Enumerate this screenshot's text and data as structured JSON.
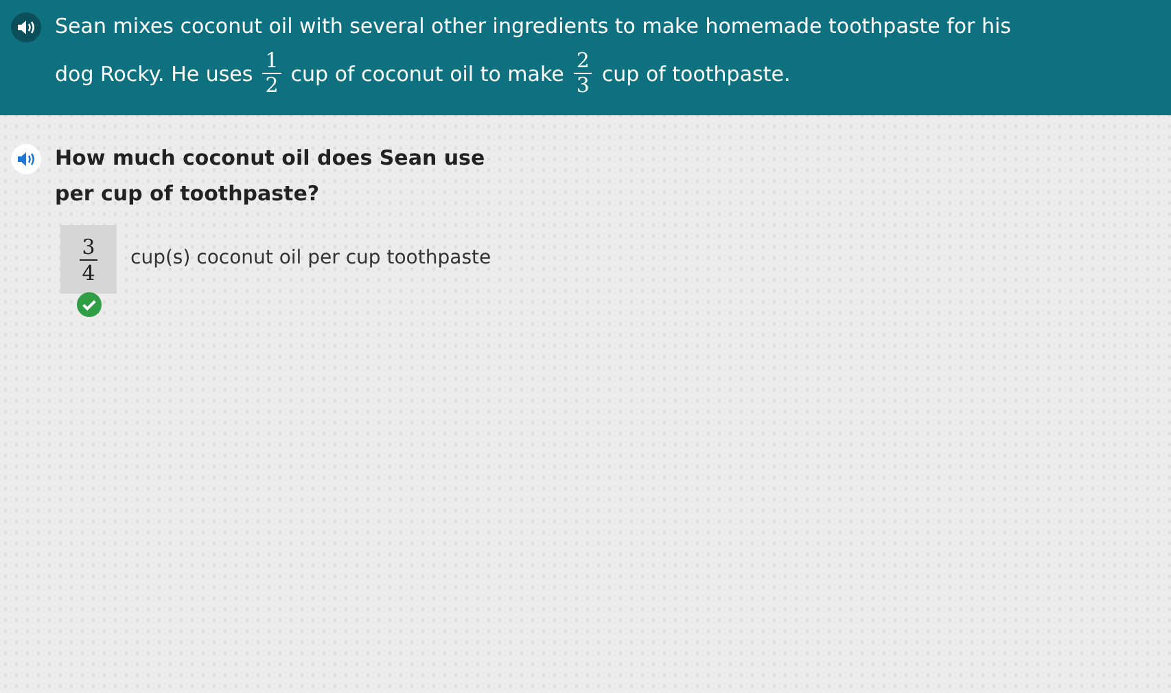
{
  "prompt": {
    "lines": [
      [
        {
          "kind": "text",
          "text": "Sean mixes coconut oil with several other ingredients to make homemade toothpaste for his"
        }
      ],
      [
        {
          "kind": "text",
          "text": "dog Rocky. He uses"
        },
        {
          "kind": "fraction",
          "numerator": "1",
          "denominator": "2"
        },
        {
          "kind": "text",
          "text": "cup of coconut oil to make"
        },
        {
          "kind": "fraction",
          "numerator": "2",
          "denominator": "3"
        },
        {
          "kind": "text",
          "text": "cup of toothpaste."
        }
      ]
    ]
  },
  "question": {
    "lines": [
      "How much coconut oil does Sean use",
      "per cup of toothpaste?"
    ]
  },
  "answer": {
    "numerator": "3",
    "denominator": "4",
    "unit": "cup(s) coconut oil per cup toothpaste",
    "correct": true
  }
}
